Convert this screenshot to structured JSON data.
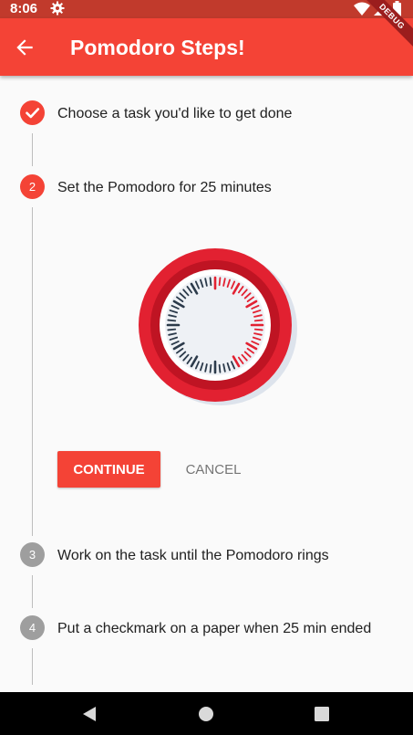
{
  "status_bar": {
    "time": "8:06",
    "icons": [
      "settings-gear-icon",
      "wifi-icon",
      "signal-icon",
      "battery-icon"
    ]
  },
  "app_bar": {
    "back_icon": "arrow-back-icon",
    "title": "Pomodoro Steps!",
    "background": "#f44336"
  },
  "debug_banner": "DEBUG",
  "stepper": {
    "steps": [
      {
        "marker": "check-icon",
        "title": "Choose a task you'd like to get done",
        "state": "complete"
      },
      {
        "marker": "2",
        "title": "Set the Pomodoro for 25 minutes",
        "state": "active"
      },
      {
        "marker": "3",
        "title": "Work on the task until the Pomodoro rings",
        "state": "inactive"
      },
      {
        "marker": "4",
        "title": "Put a checkmark on a paper when 25 min ended",
        "state": "inactive"
      }
    ],
    "content_image": "pomodoro-timer-illustration",
    "continue_label": "CONTINUE",
    "cancel_label": "CANCEL"
  },
  "colors": {
    "primary": "#f44336",
    "status_bar": "#c13a2c",
    "inactive": "#9e9e9e"
  },
  "nav_bar": {
    "icons": [
      "back-triangle-icon",
      "home-circle-icon",
      "recents-square-icon"
    ]
  }
}
